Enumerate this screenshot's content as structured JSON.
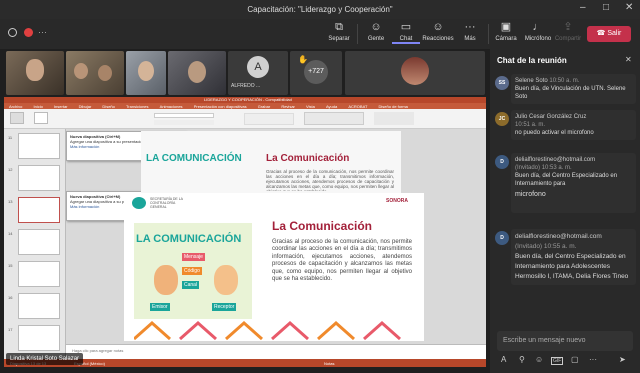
{
  "window": {
    "title": "Capacitación: \"Liderazgo y Cooperación\"",
    "minimize": "–",
    "maximize": "□",
    "close": "✕"
  },
  "toolbar": {
    "dots": "···",
    "buttons": [
      {
        "label": "Separar",
        "icon": "separate-icon"
      },
      {
        "label": "Gente",
        "icon": "people-icon"
      },
      {
        "label": "Chat",
        "icon": "chat-icon"
      },
      {
        "label": "Reacciones",
        "icon": "reactions-icon"
      },
      {
        "label": "Más",
        "icon": "more-icon"
      }
    ],
    "media": [
      {
        "label": "Cámara",
        "icon": "camera-off-icon"
      },
      {
        "label": "Micrófono",
        "icon": "microphone-off-icon"
      },
      {
        "label": "Compartir",
        "icon": "share-icon"
      }
    ],
    "leave_label": "Salir"
  },
  "gallery": {
    "tile_a_initial": "A",
    "tile_a_name": "ALFREDO ...",
    "overflow_count": "+727"
  },
  "presentation": {
    "app_title": "LIDERAZGO Y COOPERACIÓN - Compatibilidad",
    "menu": [
      "Archivo",
      "Inicio",
      "Insertar",
      "Dibujar",
      "Diseño",
      "Transiciones",
      "Animaciones",
      "Presentación con diapositivas",
      "Grabar",
      "Revisar",
      "Vista",
      "Ayuda",
      "ACROBAT",
      "Diseño de forma"
    ],
    "slide_heading": "La Comunicación",
    "slide_body": "Gracias al proceso de la comunicación, nos permite coordinar las acciones en el día a día; transmitimos información, ejecutamos acciones, atendemos procesos de capacitación y alcanzamos las metas que, como equipo, nos permiten llegar al objetivo que se ha establecido.",
    "slide_graphic_title": "LA COMUNICACIÓN",
    "bubble_labels": [
      "Mensaje",
      "Código",
      "Canal"
    ],
    "person_labels": [
      "Emisor",
      "Receptor"
    ],
    "logo_text": "SONORA",
    "dept_text": "SECRETARÍA DE LA CONTRALORÍA GENERAL",
    "notes_placeholder": "Haga clic para agregar notas",
    "new_slide_label": "Nueva diapositiva (Ctrl+M)",
    "new_slide_hint": "Agregar una diapositiva a su presentación.",
    "more_info": "Más información",
    "status_left": "Diapositiva 13 de 13",
    "status_mid": "Español (México)",
    "status_right": "Notas",
    "thumb_numbers": [
      "11",
      "12",
      "13",
      "14",
      "15",
      "16",
      "17"
    ]
  },
  "presenter_badge": "Linda Kristal Soto Salazar",
  "chat": {
    "title": "Chat de la reunión",
    "close": "✕",
    "messages": [
      {
        "initials": "SS",
        "avatar_color": "#5b6b8c",
        "author": "Selene Soto",
        "time": "10:50 a. m.",
        "text": "Buen día, de Vinculación de UTN. Selene Soto"
      },
      {
        "initials": "JC",
        "avatar_color": "#8c6b2b",
        "author": "Julio Cesar González Cruz",
        "time": "10:51 a. m.",
        "text": "no puedo activar el microfono"
      },
      {
        "initials": "D",
        "avatar_color": "#3d5a80",
        "author": "delialflorestineo@hotmail.com",
        "guest": "(Invitado)",
        "time": "10:53 a. m.",
        "text": "Buen día, del Centro Especializado en Internamiento para"
      },
      {
        "initials": "D",
        "avatar_color": "#3d5a80",
        "author": "delialflorestineo@hotmail.com",
        "guest": "(Invitado)",
        "time": "10:55 a. m.",
        "text": "Buen día, del Centro Especializado en Internamiento para Adolescentes Hermosillo I, ITAMA, Delia Flores Tineo"
      }
    ],
    "overlay_text": "microfono",
    "input_placeholder": "Escribe un mensaje nuevo",
    "composer_icons": [
      "format-icon",
      "attach-icon",
      "emoji-icon",
      "gif-icon",
      "sticker-icon",
      "more-icon"
    ]
  },
  "colors": {
    "leave": "#c4314b",
    "ppt": "#b7472a",
    "accent_teal": "#1aa59a",
    "heading_red": "#a3213a"
  }
}
